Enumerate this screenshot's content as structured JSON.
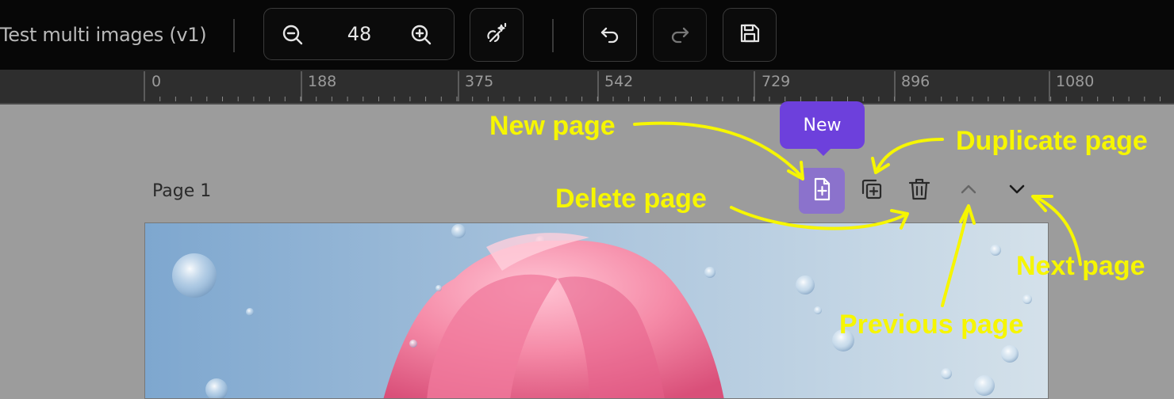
{
  "toolbar": {
    "title": "Test multi images (v1)",
    "zoom_value": "48",
    "zoom_out_icon": "zoom-out-icon",
    "zoom_in_icon": "zoom-in-icon",
    "magic_icon": "magic-wand-icon",
    "undo_icon": "undo-icon",
    "redo_icon": "redo-icon",
    "save_icon": "save-icon"
  },
  "ruler": {
    "labels": [
      "0",
      "188",
      "375",
      "542",
      "729",
      "896",
      "1080"
    ]
  },
  "page": {
    "label": "Page 1",
    "tooltip": "New",
    "actions": {
      "new_icon": "new-page-icon",
      "duplicate_icon": "duplicate-page-icon",
      "delete_icon": "trash-icon",
      "previous_icon": "chevron-up-icon",
      "next_icon": "chevron-down-icon"
    }
  },
  "annotations": {
    "new_page": "New page",
    "duplicate_page": "Duplicate page",
    "delete_page": "Delete page",
    "next_page": "Next page",
    "previous_page": "Previous page"
  },
  "colors": {
    "toolbar_bg": "#070707",
    "canvas_bg": "#9c9c9c",
    "tooltip_bg": "#6d40dc",
    "active_button": "#8b72cc",
    "annotation": "#f6f600"
  }
}
